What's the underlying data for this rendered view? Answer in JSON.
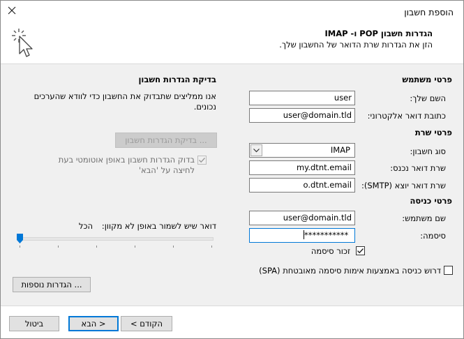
{
  "window": {
    "title": "הוספת חשבון"
  },
  "header": {
    "title": "הגדרות חשבון POP ו- IMAP",
    "subtitle": "הזן את הגדרות שרת הדואר של החשבון שלך."
  },
  "user_info": {
    "section": "פרטי משתמש",
    "name_label": "השם שלך:",
    "name_value": "user",
    "email_label": "כתובת דואר אלקטרוני:",
    "email_value": "user@domain.tld"
  },
  "server_info": {
    "section": "פרטי שרת",
    "account_type_label": "סוג חשבון:",
    "account_type_value": "IMAP",
    "incoming_label": "שרת דואר נכנס:",
    "incoming_value": "my.dtnt.email",
    "outgoing_label": "שרת דואר יוצא (SMTP):",
    "outgoing_value": "o.dtnt.email"
  },
  "logon_info": {
    "section": "פרטי כניסה",
    "username_label": "שם משתמש:",
    "username_value": "user@domain.tld",
    "password_label": "סיסמה:",
    "password_value": "***********",
    "remember_label": "זכור סיסמה",
    "remember_checked": true,
    "spa_label": "דרוש כניסה באמצעות אימות סיסמה מאובטחת (SPA)",
    "spa_checked": false
  },
  "test": {
    "section": "בדיקת הגדרות חשבון",
    "desc_line1": "אנו ממליצים שתבדוק את החשבון כדי לוודא שהערכים",
    "desc_line2": "נכונים.",
    "test_button": "בדיקת הגדרות חשבון ...",
    "auto_label_line1": "בדוק הגדרות חשבון באופן אוטומטי בעת",
    "auto_label_line2": "לחיצה על 'הבא'",
    "auto_checked": true
  },
  "offline": {
    "label": "דואר שיש לשמור באופן לא מקוון:",
    "value": "הכל",
    "slider_fraction": 1.0
  },
  "more_settings_button": "הגדרות נוספות ...",
  "footer": {
    "back": "< הקודם",
    "next": "הבא >",
    "cancel": "ביטול"
  },
  "colors": {
    "accent": "#0078d7",
    "body_bg": "#f0f0f0"
  }
}
